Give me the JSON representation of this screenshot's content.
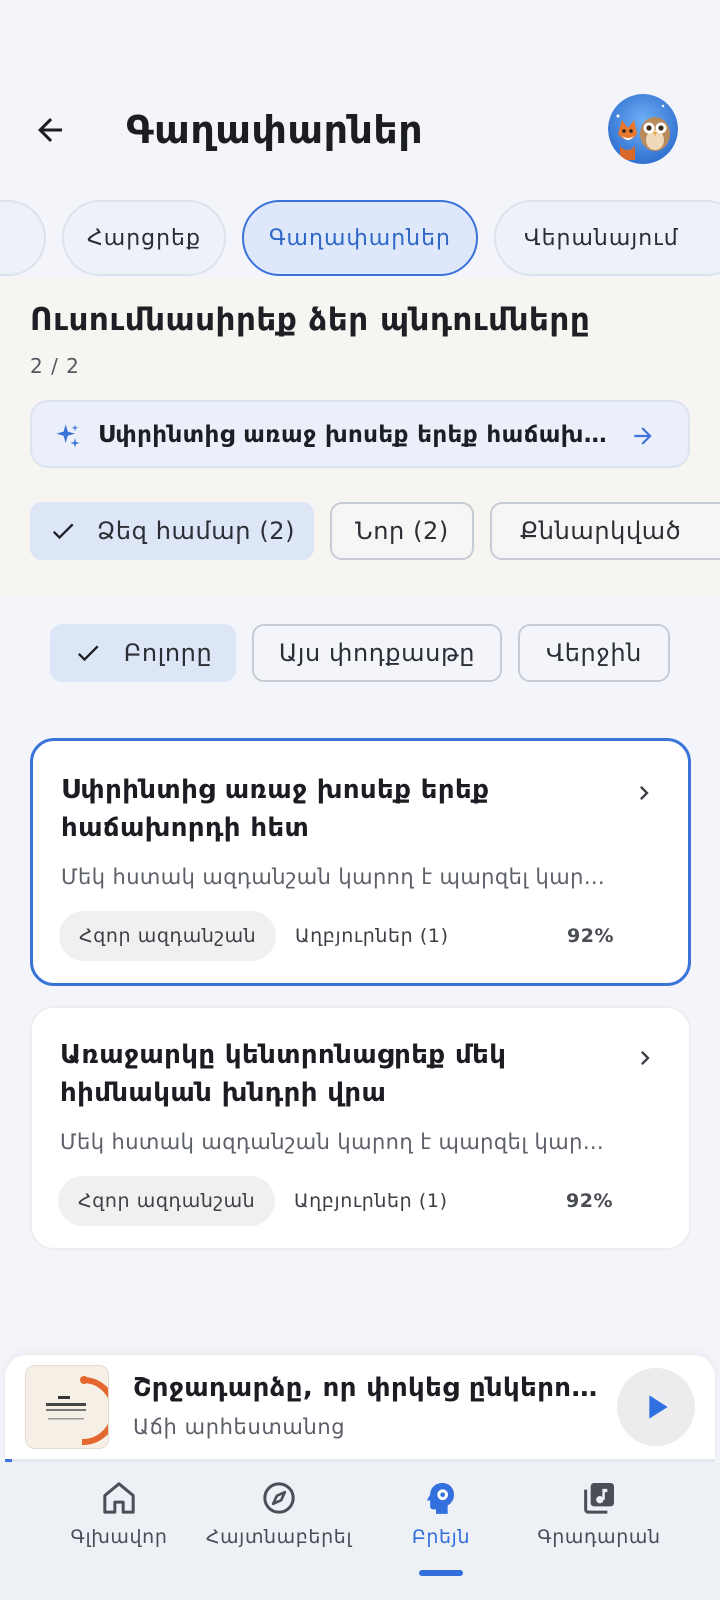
{
  "header": {
    "title": "Գաղափարներ"
  },
  "tabs": [
    {
      "label": ""
    },
    {
      "label": "Հարցրեք"
    },
    {
      "label": "Գաղափարներ"
    },
    {
      "label": "Վերանայում"
    }
  ],
  "study": {
    "title": "Ուսումնասիրեք ձեր պնդումները",
    "count": "2 / 2",
    "insight": "Սփրինտից առաջ խոսեք երեք հաճախորդի հետ",
    "chips": [
      {
        "label": "Ձեզ համար (2)",
        "selected": true
      },
      {
        "label": "Նոր (2)",
        "selected": false
      },
      {
        "label": "Քննարկված",
        "selected": false
      }
    ]
  },
  "filters": [
    {
      "label": "Բոլորը",
      "selected": true
    },
    {
      "label": "Այս փոդքասթը",
      "selected": false
    },
    {
      "label": "Վերջին",
      "selected": false
    }
  ],
  "cards": [
    {
      "title": "Սփրինտից առաջ խոսեք երեք հաճախորդի հետ",
      "description": "Մեկ հստակ ազդանշան կարող է պարզել կարևոր բաները",
      "strength": "Հզոր ազդանշան",
      "sources": "Աղբյուրներ (1)",
      "percent": "92%"
    },
    {
      "title": "Առաջարկը կենտրոնացրեք մեկ հիմնական խնդրի վրա",
      "description": "Մեկ հստակ ազդանշան կարող է պարզել կարևոր բաները",
      "strength": "Հզոր ազդանշան",
      "sources": "Աղբյուրներ (1)",
      "percent": "92%"
    }
  ],
  "player": {
    "title": "Շրջադարձը, որ փրկեց ընկերությունը",
    "subtitle": "Աճի արհեստանոց",
    "progress": 0.01
  },
  "nav": [
    {
      "label": "Գլխավոր",
      "icon": "home-icon"
    },
    {
      "label": "Հայտնաբերել",
      "icon": "compass-icon"
    },
    {
      "label": "Բրեյն",
      "icon": "brain-icon",
      "active": true
    },
    {
      "label": "Գրադարան",
      "icon": "library-music-icon"
    }
  ],
  "colors": {
    "accent": "#3370dd",
    "card_highlight": "#3a74d9",
    "background": "#f3f5fa"
  }
}
